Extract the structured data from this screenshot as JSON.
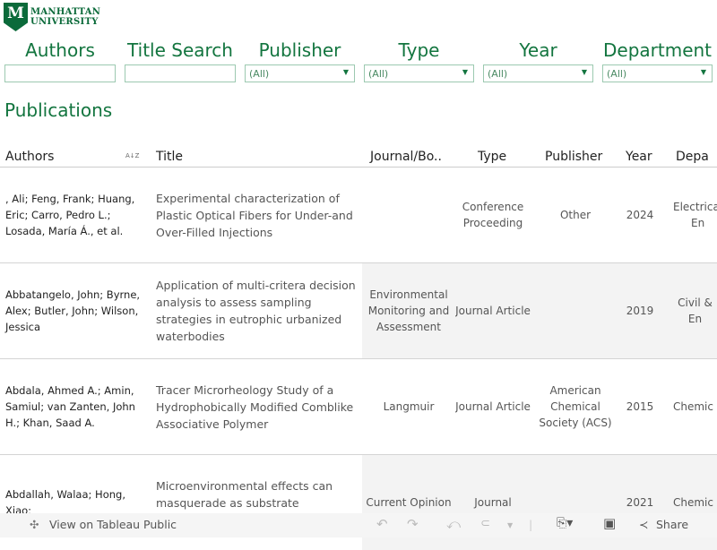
{
  "logo": {
    "line1": "MANHATTAN",
    "line2": "UNIVERSITY",
    "mark": "M"
  },
  "filters": [
    {
      "label": "Authors",
      "value": ""
    },
    {
      "label": "Title Search",
      "value": ""
    },
    {
      "label": "Publisher",
      "value": "(All)"
    },
    {
      "label": "Type",
      "value": "(All)"
    },
    {
      "label": "Year",
      "value": "(All)"
    },
    {
      "label": "Department",
      "value": "(All)"
    }
  ],
  "page_title": "Publications",
  "columns": [
    "Authors",
    "Title",
    "Journal/Bo..",
    "Type",
    "Publisher",
    "Year",
    "Depa"
  ],
  "sort_icon": "A↓Z",
  "rows": [
    {
      "authors": ", Ali; Feng, Frank; Huang, Eric; Carro, Pedro L.; Losada, María Á., et al.",
      "title": "Experimental characterization of Plastic Optical Fibers for Under-and Over-Filled Injections",
      "journal": "",
      "type": "Conference Proceeding",
      "publisher": "Other",
      "year": "2024",
      "dept": "Electrical En"
    },
    {
      "authors": "Abbatangelo, John; Byrne, Alex; Butler, John; Wilson, Jessica",
      "title": "Application of multi-critera decision analysis to assess sampling strategies in eutrophic urbanized waterbodies",
      "journal": "Environmental Monitoring and Assessment",
      "type": "Journal Article",
      "publisher": "",
      "year": "2019",
      "dept": "Civil & En"
    },
    {
      "authors": "Abdala, Ahmed A.; Amin, Samiul; van Zanten, John H.; Khan, Saad A.",
      "title": "Tracer Microrheology Study of a Hydrophobically Modified Comblike Associative Polymer",
      "journal": "Langmuir",
      "type": "Journal Article",
      "publisher": "American Chemical Society (ACS)",
      "year": "2015",
      "dept": "Chemic"
    },
    {
      "authors": "Abdallah, Walaa; Hong, Xiao;",
      "title": "Microenvironmental effects can masquerade as substrate channelling",
      "journal": "Current Opinion",
      "type": "Journal",
      "publisher": "",
      "year": "2021",
      "dept": "Chemic"
    }
  ],
  "toolbar": {
    "view_label": "View on Tableau Public",
    "share_label": "Share"
  }
}
